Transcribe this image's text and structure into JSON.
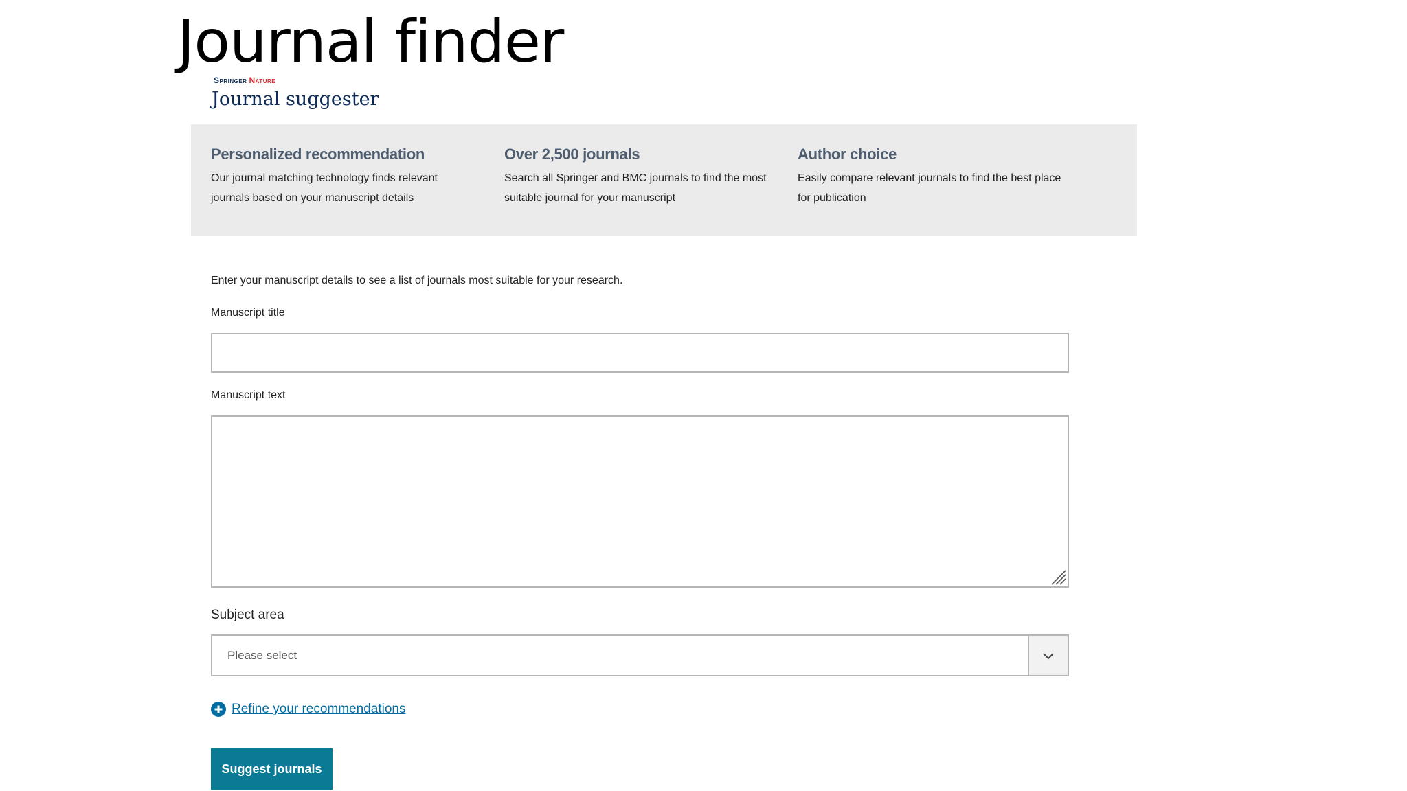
{
  "slide": {
    "title": "Journal finder"
  },
  "brand": {
    "springer": "Springer",
    "nature": "Nature",
    "app_title": "Journal suggester"
  },
  "features": [
    {
      "heading": "Personalized recommendation",
      "text": "Our journal matching technology finds relevant journals based on your manuscript details"
    },
    {
      "heading": "Over 2,500 journals",
      "text": "Search all Springer and BMC journals to find the most suitable journal for your manuscript"
    },
    {
      "heading": "Author choice",
      "text": "Easily compare relevant journals to find the best place for publication"
    }
  ],
  "form": {
    "intro": "Enter your manuscript details to see a list of journals most suitable for your research.",
    "title_label": "Manuscript title",
    "title_value": "",
    "text_label": "Manuscript text",
    "text_value": "",
    "subject_label": "Subject area",
    "subject_value": "Please select",
    "refine_label": "Refine your recommendations",
    "submit_label": "Suggest journals"
  },
  "colors": {
    "banner_bg": "#ebebeb",
    "feature_heading": "#4e5d6f",
    "link": "#006c9f",
    "button_bg": "#0b7a94",
    "brand_navy": "#0d2b57",
    "brand_red": "#e0282f"
  },
  "icons": {
    "dropdown": "chevron-down-icon",
    "refine": "plus-circle-icon",
    "resize": "resize-handle-icon"
  }
}
